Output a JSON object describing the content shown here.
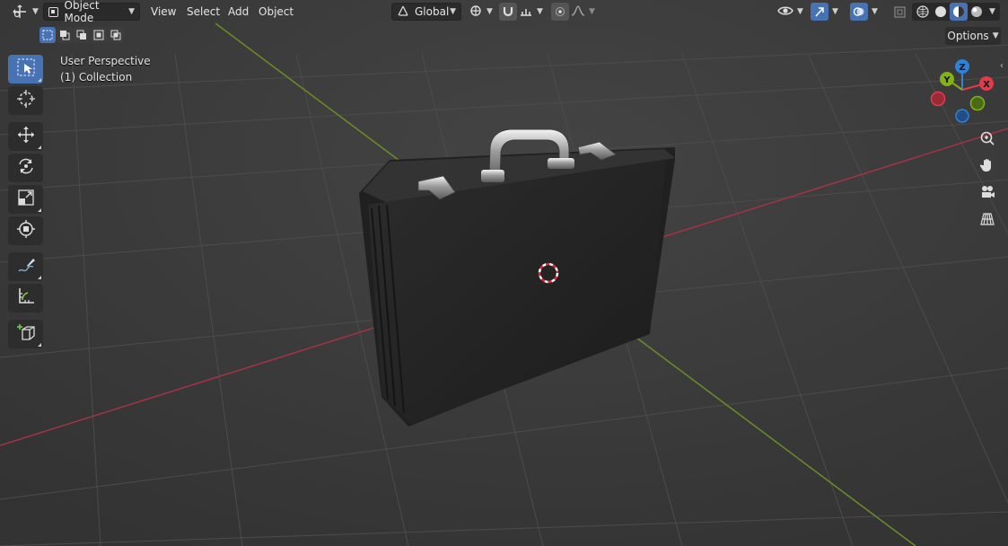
{
  "header": {
    "editor_type_icon": "move-gizmo-icon",
    "mode": {
      "icon": "object-mode-icon",
      "label": "Object Mode"
    },
    "menus": [
      "View",
      "Select",
      "Add",
      "Object"
    ],
    "transform_orientation": {
      "icon": "axes-icon",
      "label": "Global"
    },
    "snap_icon": "magnet-icon",
    "proportional_icon": "proportional-editing-icon",
    "right_icons": [
      "visibility-eye-icon",
      "gizmo-toggle-icon",
      "overlay-toggle-icon",
      "xray-icon",
      "wireframe-shading-icon",
      "solid-shading-icon",
      "material-preview-icon",
      "rendered-shading-icon"
    ]
  },
  "selection_modes": [
    "select-new-icon",
    "select-extend-icon",
    "select-subtract-icon",
    "select-invert-icon",
    "select-intersect-icon"
  ],
  "options_label": "Options",
  "viewport": {
    "view_name": "User Perspective",
    "collection": "(1) Collection"
  },
  "toolbar": [
    {
      "name": "select-box-tool",
      "icon": "select-cursor-icon",
      "active": true
    },
    {
      "name": "cursor-tool",
      "icon": "3d-cursor-icon",
      "active": false
    },
    {
      "name": "move-tool",
      "icon": "move-arrows-icon",
      "active": false
    },
    {
      "name": "rotate-tool",
      "icon": "rotate-icon",
      "active": false
    },
    {
      "name": "scale-tool",
      "icon": "scale-icon",
      "active": false
    },
    {
      "name": "transform-tool",
      "icon": "transform-icon",
      "active": false
    },
    {
      "name": "annotate-tool",
      "icon": "annotate-pen-icon",
      "active": false
    },
    {
      "name": "measure-tool",
      "icon": "ruler-icon",
      "active": false
    },
    {
      "name": "add-cube-tool",
      "icon": "add-cube-icon",
      "active": false
    }
  ],
  "gizmo": {
    "x_label": "X",
    "y_label": "Y",
    "z_label": "Z",
    "x_color": "#e33b4b",
    "y_color": "#83b11a",
    "z_color": "#2d83d6"
  },
  "nav_icons": [
    "zoom-icon",
    "hand-pan-icon",
    "camera-view-icon",
    "perspective-grid-icon"
  ],
  "colors": {
    "accent": "#4772b3",
    "viewport_bg": "#393939",
    "x_axis_line": "#a23446",
    "y_axis_line": "#6b8e23"
  }
}
